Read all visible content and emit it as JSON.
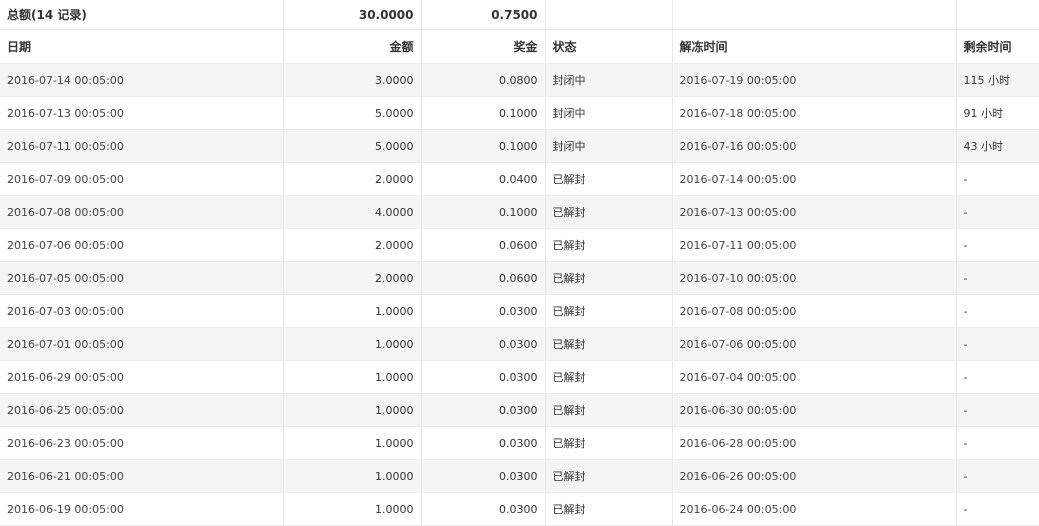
{
  "summary": {
    "label": "总额(14 记录)",
    "amount_total": "30.0000",
    "bonus_total": "0.7500"
  },
  "columns": {
    "date": "日期",
    "amount": "金额",
    "bonus": "奖金",
    "status": "状态",
    "unlock_time": "解冻时间",
    "remaining": "剩余时间"
  },
  "rows": [
    {
      "date": "2016-07-14 00:05:00",
      "amount": "3.0000",
      "bonus": "0.0800",
      "status": "封闭中",
      "unlock_time": "2016-07-19 00:05:00",
      "remaining": "115 小时"
    },
    {
      "date": "2016-07-13 00:05:00",
      "amount": "5.0000",
      "bonus": "0.1000",
      "status": "封闭中",
      "unlock_time": "2016-07-18 00:05:00",
      "remaining": "91 小时"
    },
    {
      "date": "2016-07-11 00:05:00",
      "amount": "5.0000",
      "bonus": "0.1000",
      "status": "封闭中",
      "unlock_time": "2016-07-16 00:05:00",
      "remaining": "43 小时"
    },
    {
      "date": "2016-07-09 00:05:00",
      "amount": "2.0000",
      "bonus": "0.0400",
      "status": "已解封",
      "unlock_time": "2016-07-14 00:05:00",
      "remaining": "-"
    },
    {
      "date": "2016-07-08 00:05:00",
      "amount": "4.0000",
      "bonus": "0.1000",
      "status": "已解封",
      "unlock_time": "2016-07-13 00:05:00",
      "remaining": "-"
    },
    {
      "date": "2016-07-06 00:05:00",
      "amount": "2.0000",
      "bonus": "0.0600",
      "status": "已解封",
      "unlock_time": "2016-07-11 00:05:00",
      "remaining": "-"
    },
    {
      "date": "2016-07-05 00:05:00",
      "amount": "2.0000",
      "bonus": "0.0600",
      "status": "已解封",
      "unlock_time": "2016-07-10 00:05:00",
      "remaining": "-"
    },
    {
      "date": "2016-07-03 00:05:00",
      "amount": "1.0000",
      "bonus": "0.0300",
      "status": "已解封",
      "unlock_time": "2016-07-08 00:05:00",
      "remaining": "-"
    },
    {
      "date": "2016-07-01 00:05:00",
      "amount": "1.0000",
      "bonus": "0.0300",
      "status": "已解封",
      "unlock_time": "2016-07-06 00:05:00",
      "remaining": "-"
    },
    {
      "date": "2016-06-29 00:05:00",
      "amount": "1.0000",
      "bonus": "0.0300",
      "status": "已解封",
      "unlock_time": "2016-07-04 00:05:00",
      "remaining": "-"
    },
    {
      "date": "2016-06-25 00:05:00",
      "amount": "1.0000",
      "bonus": "0.0300",
      "status": "已解封",
      "unlock_time": "2016-06-30 00:05:00",
      "remaining": "-"
    },
    {
      "date": "2016-06-23 00:05:00",
      "amount": "1.0000",
      "bonus": "0.0300",
      "status": "已解封",
      "unlock_time": "2016-06-28 00:05:00",
      "remaining": "-"
    },
    {
      "date": "2016-06-21 00:05:00",
      "amount": "1.0000",
      "bonus": "0.0300",
      "status": "已解封",
      "unlock_time": "2016-06-26 00:05:00",
      "remaining": "-"
    },
    {
      "date": "2016-06-19 00:05:00",
      "amount": "1.0000",
      "bonus": "0.0300",
      "status": "已解封",
      "unlock_time": "2016-06-24 00:05:00",
      "remaining": "-"
    }
  ]
}
